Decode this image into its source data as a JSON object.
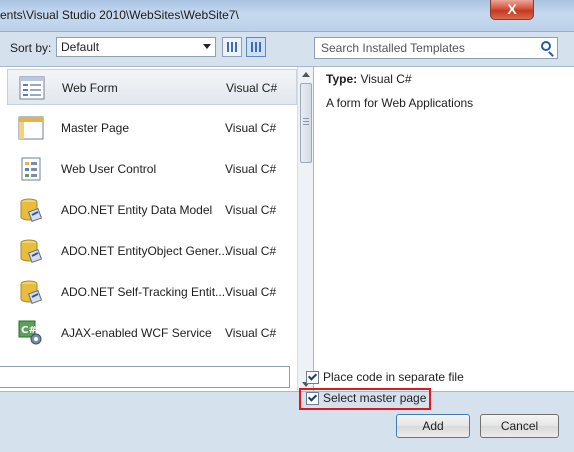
{
  "window": {
    "title": "ents\\Visual Studio 2010\\WebSites\\WebSite7\\",
    "close_glyph": "X"
  },
  "toolbar": {
    "sort_label": "Sort by:",
    "sort_value": "Default",
    "search_placeholder": "Search Installed Templates"
  },
  "templates": [
    {
      "name": "Web Form",
      "lang": "Visual C#",
      "icon": "web-form-icon"
    },
    {
      "name": "Master Page",
      "lang": "Visual C#",
      "icon": "master-page-icon"
    },
    {
      "name": "Web User Control",
      "lang": "Visual C#",
      "icon": "user-control-icon"
    },
    {
      "name": "ADO.NET Entity Data Model",
      "lang": "Visual C#",
      "icon": "database-icon"
    },
    {
      "name": "ADO.NET EntityObject Gener...",
      "lang": "Visual C#",
      "icon": "database-icon"
    },
    {
      "name": "ADO.NET Self-Tracking Entit...",
      "lang": "Visual C#",
      "icon": "database-icon"
    },
    {
      "name": "AJAX-enabled WCF Service",
      "lang": "Visual C#",
      "icon": "wcf-service-icon"
    }
  ],
  "details": {
    "type_label": "Type:",
    "type_value": "Visual C#",
    "description": "A form for Web Applications"
  },
  "options": {
    "separate_file_label": "Place code in separate file",
    "separate_file_checked": true,
    "master_page_label": "Select master page",
    "master_page_checked": true
  },
  "buttons": {
    "add": "Add",
    "cancel": "Cancel"
  },
  "colors": {
    "highlight": "#e0181e",
    "dialog_bg": "#d6e1ee"
  }
}
